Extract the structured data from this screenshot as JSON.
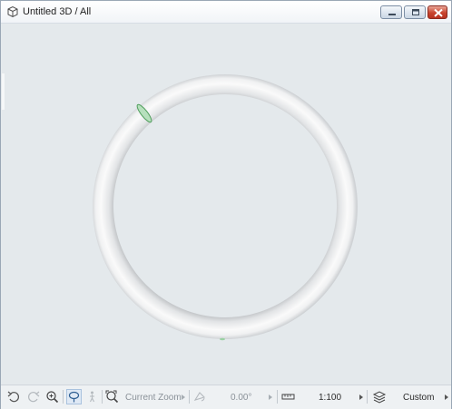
{
  "window": {
    "title": "Untitled 3D / All",
    "controls": {
      "minimize": "minimize-icon",
      "maximize": "maximize-icon",
      "close": "close-icon"
    }
  },
  "viewport": {
    "model": "torus",
    "background_color": "#e4e9ec",
    "model_color": "#f7f7f7",
    "highlight_color": "#6fc07a"
  },
  "statusbar": {
    "zoom_label": "Current Zoom",
    "rotation_value": "0.00°",
    "scale_value": "1:100",
    "layer_combination": "Custom",
    "icons": [
      "undo-view-icon",
      "redo-view-icon",
      "zoom-icon",
      "orbit-icon",
      "walk-icon",
      "zoom-to-fit-icon",
      "rotation-icon",
      "ruler-icon",
      "layers-icon"
    ],
    "colors": {
      "active_background": "#dfe9f5",
      "active_border": "#a9c2de"
    }
  }
}
